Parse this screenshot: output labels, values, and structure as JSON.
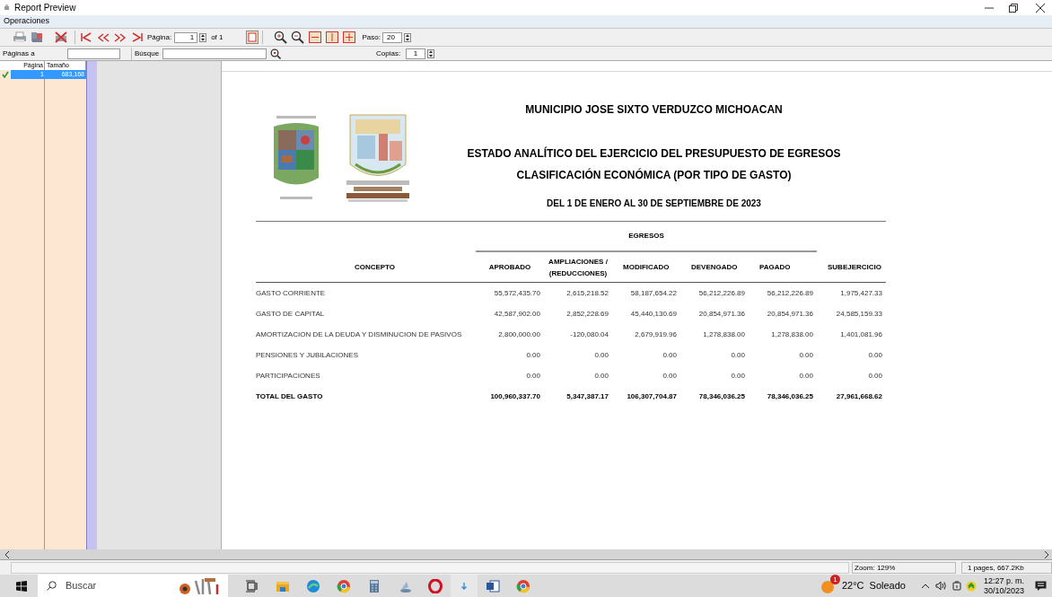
{
  "window": {
    "title": "Report Preview"
  },
  "menu": [
    "Operaciones"
  ],
  "toolbar": {
    "page_label": "Página:",
    "page_value": "1",
    "page_of": "of 1",
    "step_label": "Paso:",
    "step_value": "20"
  },
  "search_bar": {
    "pages_label": "Páginas a",
    "search_label": "Búsque",
    "copies_label": "Copias:",
    "copies_value": "1"
  },
  "page_list": {
    "columns": [
      "Página",
      "Tamaño"
    ],
    "rows": [
      {
        "page": "1",
        "size": "683,168",
        "selected": true,
        "checked": true
      }
    ]
  },
  "report": {
    "title": "MUNICIPIO JOSE SIXTO VERDUZCO MICHOACAN",
    "subtitle_1": "ESTADO ANALÍTICO DEL EJERCICIO DEL PRESUPUESTO DE EGRESOS",
    "subtitle_2": "CLASIFICACIÓN ECONÓMICA (POR TIPO DE GASTO)",
    "period": "DEL 1 DE ENERO AL 30 DE SEPTIEMBRE DE 2023",
    "group_header": "EGRESOS",
    "columns": [
      "CONCEPTO",
      "APROBADO",
      "AMPLIACIONES /\n(REDUCCIONES)",
      "MODIFICADO",
      "DEVENGADO",
      "PAGADO",
      "SUBEJERCICIO"
    ],
    "rows": [
      {
        "total": false,
        "cells": [
          "GASTO CORRIENTE",
          "55,572,435.70",
          "2,615,218.52",
          "58,187,654.22",
          "56,212,226.89",
          "56,212,226.89",
          "1,975,427.33"
        ]
      },
      {
        "total": false,
        "cells": [
          "GASTO DE CAPITAL",
          "42,587,902.00",
          "2,852,228.69",
          "45,440,130.69",
          "20,854,971.36",
          "20,854,971.36",
          "24,585,159.33"
        ]
      },
      {
        "total": false,
        "cells": [
          "AMORTIZACION DE LA DEUDA Y DISMINUCION DE PASIVOS",
          "2,800,000.00",
          "-120,080.04",
          "2,679,919.96",
          "1,278,838.00",
          "1,278,838.00",
          "1,401,081.96"
        ]
      },
      {
        "total": false,
        "cells": [
          "PENSIONES Y JUBILACIONES",
          "0.00",
          "0.00",
          "0.00",
          "0.00",
          "0.00",
          "0.00"
        ]
      },
      {
        "total": false,
        "cells": [
          "PARTICIPACIONES",
          "0.00",
          "0.00",
          "0.00",
          "0.00",
          "0.00",
          "0.00"
        ]
      },
      {
        "total": true,
        "cells": [
          "TOTAL DEL GASTO",
          "100,960,337.70",
          "5,347,387.17",
          "106,307,704.87",
          "78,346,036.25",
          "78,346,036.25",
          "27,961,668.62"
        ]
      }
    ]
  },
  "status_bar": {
    "zoom": "Zoom: 129%",
    "info": "1 pages, 667.2Kb"
  },
  "taskbar": {
    "search_placeholder": "Buscar",
    "weather_badge": "1",
    "weather": "22°C  Soleado",
    "time": "12:27 p. m.",
    "date": "30/10/2023"
  }
}
